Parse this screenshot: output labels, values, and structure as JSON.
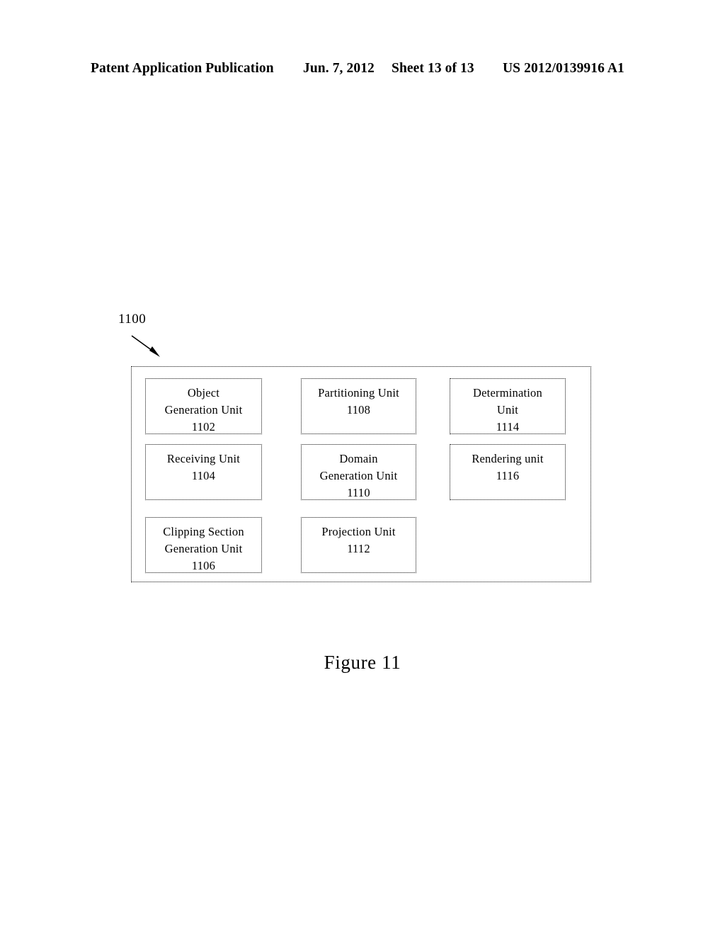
{
  "header": {
    "publication": "Patent Application Publication",
    "date": "Jun. 7, 2012",
    "sheet": "Sheet 13 of 13",
    "doc_number": "US 2012/0139916 A1"
  },
  "figure": {
    "reference_label": "1100",
    "caption": "Figure 11",
    "arrow_icon": "diagonal-lead-line-arrow",
    "units": [
      {
        "id": "1102",
        "lines": [
          "Object",
          "Generation Unit",
          "1102"
        ],
        "column": 1,
        "row": 1
      },
      {
        "id": "1104",
        "lines": [
          "Receiving Unit",
          "1104"
        ],
        "column": 1,
        "row": 2
      },
      {
        "id": "1106",
        "lines": [
          "Clipping Section",
          "Generation Unit",
          "1106"
        ],
        "column": 1,
        "row": 3
      },
      {
        "id": "1108",
        "lines": [
          "Partitioning Unit",
          "1108"
        ],
        "column": 2,
        "row": 1
      },
      {
        "id": "1110",
        "lines": [
          "Domain",
          "Generation Unit",
          "1110"
        ],
        "column": 2,
        "row": 2
      },
      {
        "id": "1112",
        "lines": [
          "Projection Unit",
          "1112"
        ],
        "column": 2,
        "row": 3
      },
      {
        "id": "1114",
        "lines": [
          "Determination",
          "Unit",
          "1114"
        ],
        "column": 3,
        "row": 1
      },
      {
        "id": "1116",
        "lines": [
          "Rendering unit",
          "1116"
        ],
        "column": 3,
        "row": 2
      }
    ]
  },
  "colors": {
    "ink": "#000000",
    "paper": "#ffffff"
  }
}
